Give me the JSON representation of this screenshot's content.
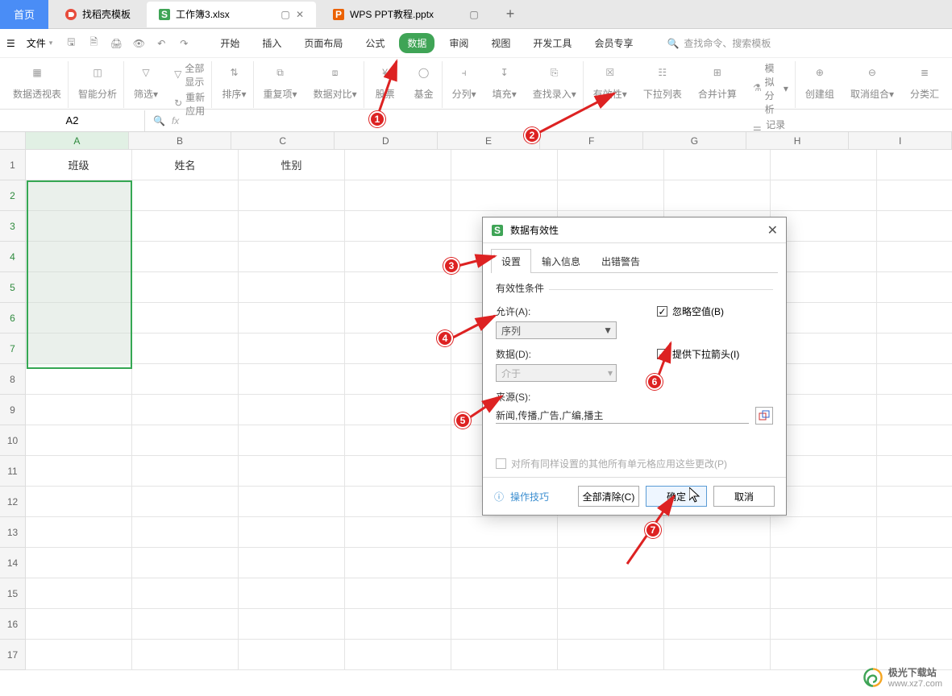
{
  "tabs": {
    "home": "首页",
    "doc1": "找稻壳模板",
    "doc2": "工作簿3.xlsx",
    "doc3": "WPS PPT教程.pptx"
  },
  "menu": {
    "file": "文件",
    "items": [
      "开始",
      "插入",
      "页面布局",
      "公式",
      "数据",
      "审阅",
      "视图",
      "开发工具",
      "会员专享"
    ],
    "active_index": 4,
    "search": "查找命令、搜索模板"
  },
  "ribbon": {
    "pivot": "数据透视表",
    "smart": "智能分析",
    "filter": "筛选",
    "show_all": "全部显示",
    "reapply": "重新应用",
    "sort": "排序",
    "dedup": "重复项",
    "compare": "数据对比",
    "stock": "股票",
    "fund": "基金",
    "split": "分列",
    "fill": "填充",
    "find_rec": "查找录入",
    "validity": "有效性",
    "dropdown": "下拉列表",
    "consolidate": "合并计算",
    "sim": "模拟分析",
    "record": "记录单",
    "group": "创建组",
    "ungroup": "取消组合",
    "subtotal": "分类汇"
  },
  "name_box": "A2",
  "headers": {
    "A": "班级",
    "B": "姓名",
    "C": "性别"
  },
  "cols": [
    "A",
    "B",
    "C",
    "D",
    "E",
    "F",
    "G",
    "H",
    "I"
  ],
  "dialog": {
    "title": "数据有效性",
    "tabs": [
      "设置",
      "输入信息",
      "出错警告"
    ],
    "section": "有效性条件",
    "allow_lbl": "允许(A):",
    "allow_val": "序列",
    "data_lbl": "数据(D):",
    "data_val": "介于",
    "ignore": "忽略空值(B)",
    "dropdown": "提供下拉箭头(I)",
    "source_lbl": "来源(S):",
    "source_val": "新闻,传播,广告,广编,播主",
    "apply_all": "对所有同样设置的其他所有单元格应用这些更改(P)",
    "tips": "操作技巧",
    "clear": "全部清除(C)",
    "ok": "确定",
    "cancel": "取消"
  },
  "badges": [
    "1",
    "2",
    "3",
    "4",
    "5",
    "6",
    "7"
  ],
  "watermark": {
    "name": "极光下载站",
    "url": "www.xz7.com"
  }
}
